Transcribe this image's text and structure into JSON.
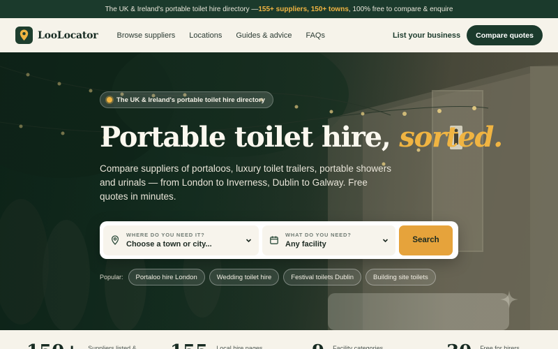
{
  "announcement": {
    "prefix": "The UK & Ireland's portable toilet hire directory — ",
    "highlight": "155+ suppliers, 150+ towns",
    "suffix": ", 100% free to compare & enquire"
  },
  "header": {
    "logo_text": "LooLocator",
    "nav": [
      "Browse suppliers",
      "Locations",
      "Guides & advice",
      "FAQs"
    ],
    "list_business": "List your business",
    "compare_button": "Compare quotes"
  },
  "hero": {
    "pill": "The UK & Ireland's portable toilet hire directory",
    "headline_main": "Portable toilet hire, ",
    "headline_accent": "sorted.",
    "subtitle": "Compare suppliers of portaloos, luxury toilet trailers, portable showers and urinals — from London to Inverness, Dublin to Galway. Free quotes in minutes."
  },
  "search": {
    "where_label": "WHERE DO YOU NEED IT?",
    "where_value": "Choose a town or city...",
    "what_label": "WHAT DO YOU NEED?",
    "what_value": "Any facility",
    "button": "Search"
  },
  "popular": {
    "label": "Popular:",
    "chips": [
      "Portaloo hire London",
      "Wedding toilet hire",
      "Festival toilets Dublin",
      "Building site toilets"
    ]
  },
  "stats": [
    {
      "num": "150+",
      "text": "Suppliers listed &"
    },
    {
      "num": "155",
      "text": "Local hire pages"
    },
    {
      "num": "9",
      "text": "Facility categories"
    },
    {
      "num": "30",
      "text": "Free for hirers"
    }
  ],
  "colors": {
    "brand_dark": "#1b3a2c",
    "accent": "#f0b442",
    "search_button": "#e6a33b",
    "cream": "#f6f3ea"
  },
  "icons": {
    "logo": "map-pin-icon",
    "where": "map-pin-icon",
    "what": "calendar-icon",
    "dropdown": "chevron-down-icon",
    "decor": "sparkle-icon"
  }
}
